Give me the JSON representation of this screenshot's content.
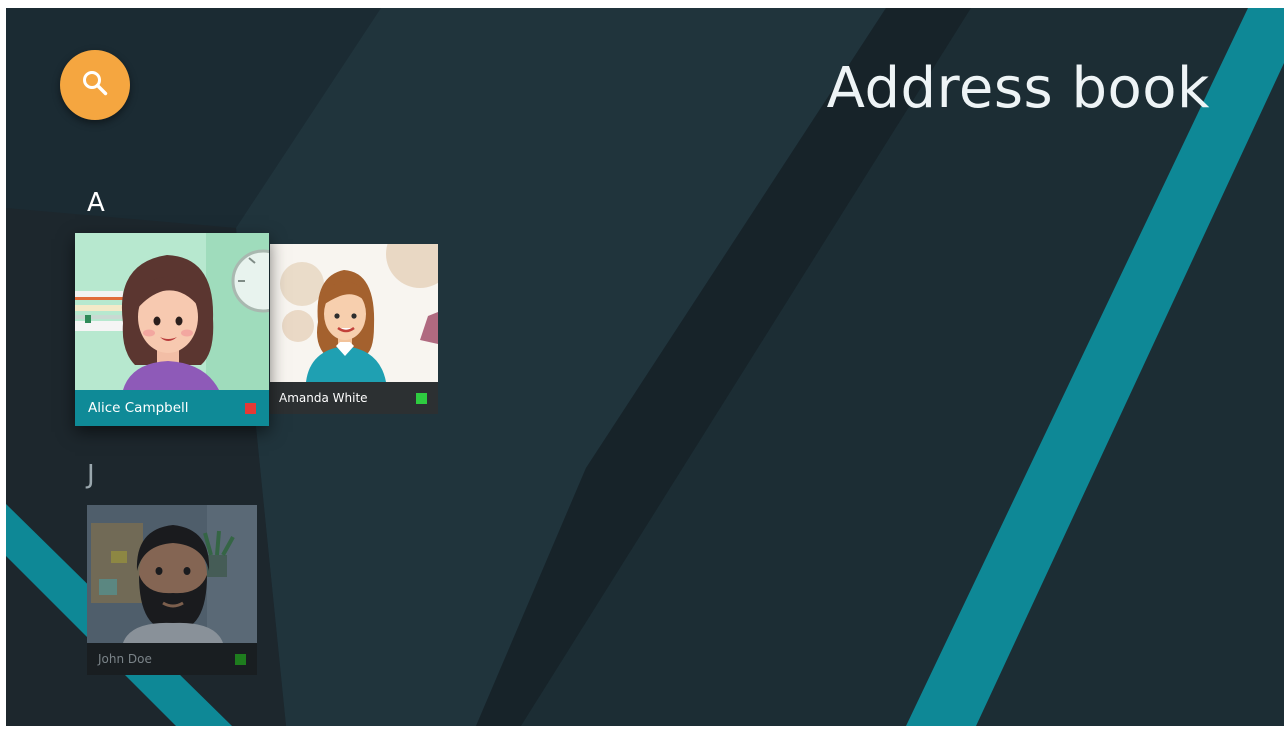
{
  "app": {
    "title": "Address book"
  },
  "colors": {
    "background": "#1b2b33",
    "accent_teal": "#0f8a97",
    "search_button": "#f5a640",
    "status_busy": "#e53935",
    "status_available": "#2ecc40",
    "status_available_dim": "#1e7d1e"
  },
  "search": {
    "icon": "search-icon"
  },
  "sections": [
    {
      "letter": "A",
      "contacts": [
        {
          "name": "Alice Campbell",
          "status": "busy",
          "focused": true
        },
        {
          "name": "Amanda White",
          "status": "available",
          "focused": false
        }
      ]
    },
    {
      "letter": "J",
      "contacts": [
        {
          "name": "John Doe",
          "status": "available",
          "focused": false
        }
      ]
    }
  ]
}
